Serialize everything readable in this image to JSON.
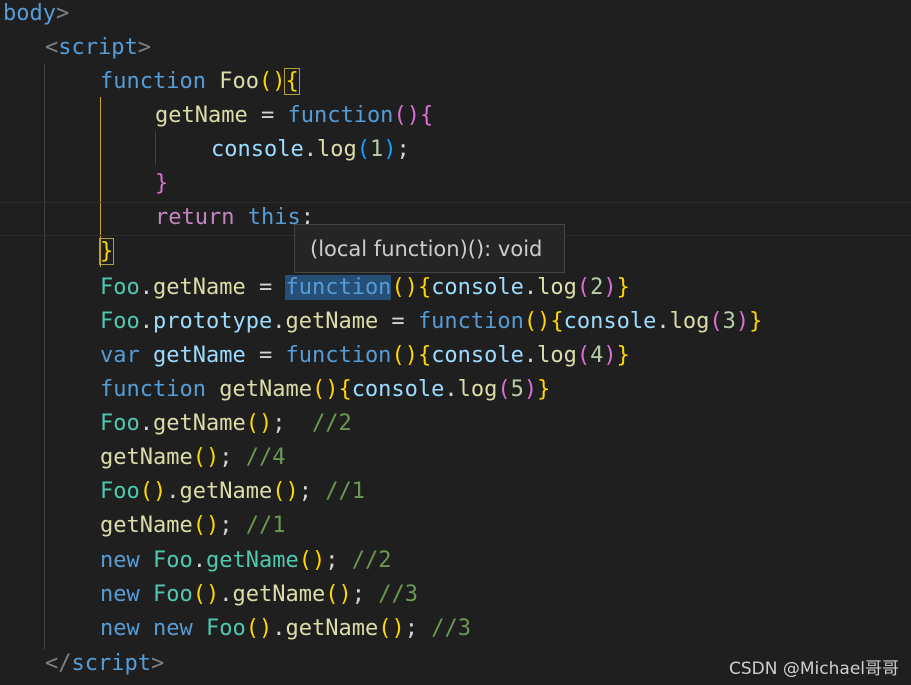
{
  "code": {
    "line01": {
      "tag": "body",
      "close": ">"
    },
    "line02": {
      "open": "<",
      "tag": "script",
      "close": ">"
    },
    "line03": {
      "kw": "function",
      "name": "Foo",
      "paren_open": "(",
      "paren_close": ")",
      "brace": "{"
    },
    "line04": {
      "var": "getName",
      "eq": " = ",
      "kw": "function",
      "paren_open": "(",
      "paren_close": ")",
      "brace": "{"
    },
    "line05": {
      "obj": "console",
      "dot": ".",
      "method": "log",
      "paren_open": "(",
      "num": "1",
      "paren_close": ")",
      "semi": ";"
    },
    "line06": {
      "brace": "}"
    },
    "line07": {
      "kw": "return",
      "this": "this",
      "semi": ";"
    },
    "line08": {
      "brace": "}"
    },
    "line09": {
      "obj": "Foo",
      "dot": ".",
      "prop": "getName",
      "eq": " = ",
      "kw": "function",
      "p_open": "(",
      "p_close": ")",
      "b_open": "{",
      "console": "console",
      "dot2": ".",
      "log": "log",
      "lp": "(",
      "num": "2",
      "rp": ")",
      "b_close": "}"
    },
    "line10": {
      "obj": "Foo",
      "dot": ".",
      "proto": "prototype",
      "dot2": ".",
      "prop": "getName",
      "eq": " = ",
      "kw": "function",
      "p_open": "(",
      "p_close": ")",
      "b_open": "{",
      "console": "console",
      "dot3": ".",
      "log": "log",
      "lp": "(",
      "num": "3",
      "rp": ")",
      "b_close": "}"
    },
    "line11": {
      "kw": "var",
      "var": "getName",
      "eq": " = ",
      "kw2": "function",
      "p_open": "(",
      "p_close": ")",
      "b_open": "{",
      "console": "console",
      "dot": ".",
      "log": "log",
      "lp": "(",
      "num": "4",
      "rp": ")",
      "b_close": "}"
    },
    "line12": {
      "kw": "function",
      "name": "getName",
      "p_open": "(",
      "p_close": ")",
      "b_open": "{",
      "console": "console",
      "dot": ".",
      "log": "log",
      "lp": "(",
      "num": "5",
      "rp": ")",
      "b_close": "}"
    },
    "line13": {
      "obj": "Foo",
      "dot": ".",
      "call": "getName",
      "parens": "()",
      "semi": ";",
      "comment": "  //2"
    },
    "line14": {
      "call": "getName",
      "parens": "()",
      "semi": ";",
      "comment": " //4"
    },
    "line15": {
      "obj": "Foo",
      "parens1": "()",
      "dot": ".",
      "call": "getName",
      "parens2": "()",
      "semi": ";",
      "comment": " //1"
    },
    "line16": {
      "call": "getName",
      "parens": "()",
      "semi": ";",
      "comment": " //1"
    },
    "line17": {
      "kw": "new",
      "obj": "Foo",
      "dot": ".",
      "call": "getName",
      "parens": "()",
      "semi": ";",
      "comment": " //2"
    },
    "line18": {
      "kw": "new",
      "obj": "Foo",
      "parens1": "()",
      "dot": ".",
      "call": "getName",
      "parens2": "()",
      "semi": ";",
      "comment": " //3"
    },
    "line19": {
      "kw1": "new",
      "kw2": "new",
      "obj": "Foo",
      "parens1": "()",
      "dot": ".",
      "call": "getName",
      "parens2": "()",
      "semi": ";",
      "comment": " //3"
    },
    "line20": {
      "open": "</",
      "tag": "script",
      "close": ">"
    }
  },
  "hover": {
    "tooltip": "(local function)(): void"
  },
  "watermark": "CSDN @Michael哥哥"
}
